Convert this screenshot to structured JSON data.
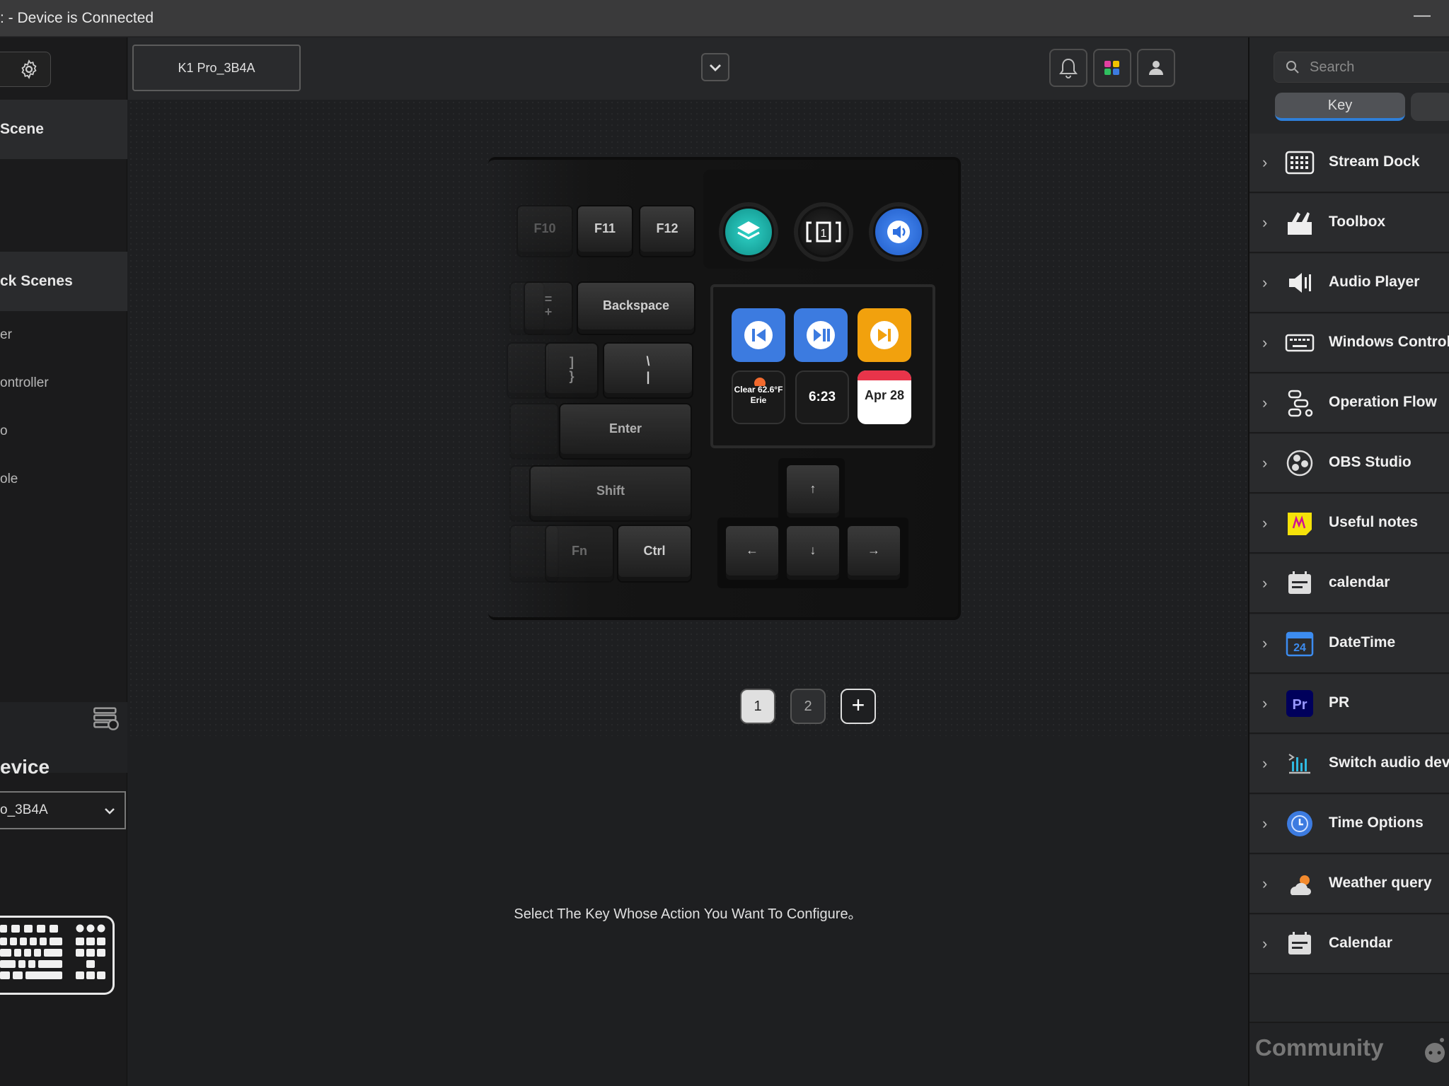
{
  "window": {
    "title": ": - Device is Connected",
    "minimize": "—"
  },
  "left": {
    "scene_header": "Scene",
    "dock_scenes_header": "ck Scenes",
    "items": [
      "er",
      "ontroller",
      "o",
      "ole"
    ],
    "device_title": "evice",
    "device_select": "o_3B4A"
  },
  "topbar": {
    "device_tab": "K1 Pro_3B4A"
  },
  "keyboard": {
    "fkeys": [
      "F10",
      "F11",
      "F12"
    ],
    "backspace": "Backspace",
    "enter": "Enter",
    "shift": "Shift",
    "fn": "Fn",
    "ctrl": "Ctrl",
    "pipe_top": "\\",
    "pipe_bot": "|",
    "brace_top": "]",
    "brace_bot": "}",
    "plus_top": "=",
    "plus_bot": "+",
    "arrow_up": "↑",
    "arrow_left": "←",
    "arrow_down": "↓",
    "arrow_right": "→",
    "weather_line1": "Clear",
    "weather_line2": "62.6°F",
    "weather_line3": "Erie",
    "clock": "6:23",
    "date_month": "Apr",
    "date_day": "28"
  },
  "pages": [
    "1",
    "2",
    "+"
  ],
  "hint": "Select The Key Whose Action You Want To Configure。",
  "right": {
    "search_placeholder": "Search",
    "tab_key": "Key",
    "items": [
      "Stream Dock",
      "Toolbox",
      "Audio Player",
      "Windows Control",
      "Operation Flow",
      "OBS Studio",
      "Useful notes",
      "calendar",
      "DateTime",
      "PR",
      "Switch audio devi",
      "Time Options",
      "Weather query",
      "Calendar"
    ],
    "community": "Community"
  },
  "colors": {
    "accent": "#2e7fd9",
    "orange": "#f2a10d",
    "blue_key": "#3c7be0",
    "teal": "#22c1b8"
  }
}
